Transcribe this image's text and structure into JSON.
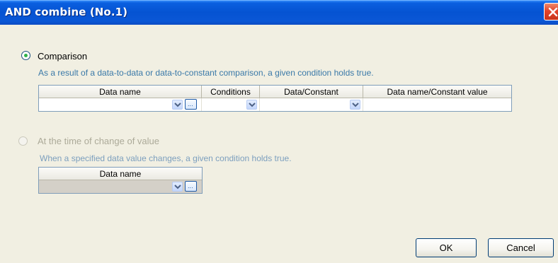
{
  "window": {
    "title": "AND combine (No.1)"
  },
  "comparison": {
    "label": "Comparison",
    "selected": true,
    "description": "As a result of a data-to-data or data-to-constant comparison, a given condition holds true.",
    "columns": [
      "Data name",
      "Conditions",
      "Data/Constant",
      "Data name/Constant value"
    ],
    "row": {
      "data_name": "",
      "conditions": "",
      "data_constant": "",
      "constant_value": ""
    }
  },
  "change": {
    "label": "At the time of change of value",
    "selected": false,
    "description": "When a specified data value changes, a given condition holds true.",
    "columns": [
      "Data name"
    ],
    "row": {
      "data_name": ""
    }
  },
  "buttons": {
    "ok": "OK",
    "cancel": "Cancel"
  },
  "icons": {
    "close": "close-icon",
    "dropdown": "chevron-down-icon",
    "ellipsis": "ellipsis-icon"
  },
  "colors": {
    "titlebar": "#0553d2",
    "description": "#3a79a8",
    "selected_dot": "#2fb24a"
  }
}
